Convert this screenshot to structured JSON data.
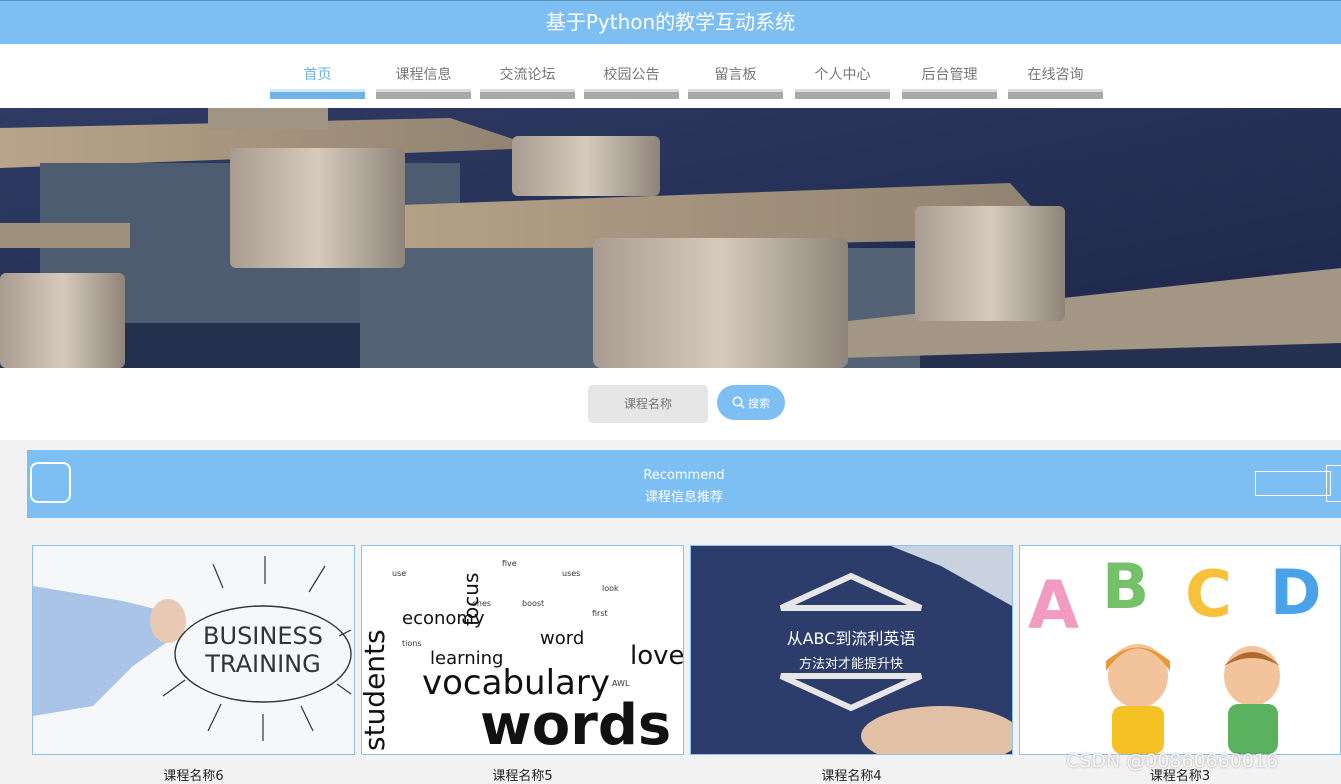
{
  "header": {
    "title": "基于Python的教学互动系统"
  },
  "nav": {
    "items": [
      {
        "label": "首页",
        "active": true
      },
      {
        "label": "课程信息"
      },
      {
        "label": "交流论坛"
      },
      {
        "label": "校园公告"
      },
      {
        "label": "留言板"
      },
      {
        "label": "个人中心"
      },
      {
        "label": "后台管理"
      },
      {
        "label": "在线咨询"
      }
    ]
  },
  "search": {
    "placeholder": "课程名称",
    "button_label": "搜索"
  },
  "recommend": {
    "title_en": "Recommend",
    "title_cn": "课程信息推荐"
  },
  "cards": [
    {
      "name": "课程名称6",
      "image_text": [
        "BUSINESS",
        "TRAINING"
      ]
    },
    {
      "name": "课程名称5",
      "image_text": [
        "vocabulary",
        "words",
        "learning",
        "economy",
        "students",
        "love",
        "word",
        "focus"
      ]
    },
    {
      "name": "课程名称4",
      "image_text": [
        "从ABC到流利英语",
        "方法对才能提升快"
      ]
    },
    {
      "name": "课程名称3",
      "image_text": [
        "A",
        "B",
        "C",
        "D"
      ]
    }
  ],
  "watermark": "CSDN @00860660016",
  "colors": {
    "accent": "#7dbff3",
    "active_nav": "#6fb3e8",
    "card_border": "#8cc3ee"
  }
}
